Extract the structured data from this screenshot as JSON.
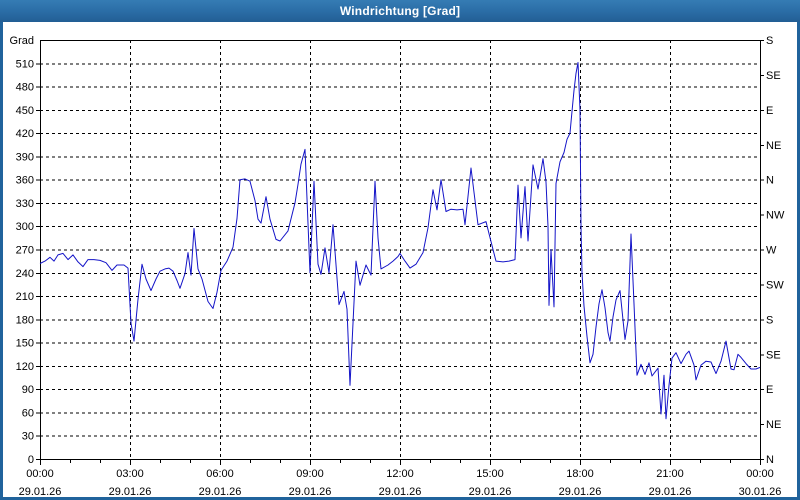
{
  "window": {
    "title": "Windrichtung [Grad]"
  },
  "colors": {
    "titlebar_blue": "#2a6ca5",
    "window_border_blue": "#20639c",
    "plot_background": "#ffffff",
    "grid_black": "#000000",
    "series_blue": "#1414c8"
  },
  "chart_data": {
    "type": "line",
    "title": "Windrichtung [Grad]",
    "grid": "on",
    "legend": "none",
    "y_axis": {
      "header_label": "Grad",
      "min": 0,
      "max": 540,
      "tick_step": 30,
      "tick_labels": [
        510,
        480,
        450,
        420,
        390,
        360,
        330,
        300,
        270,
        240,
        210,
        180,
        150,
        120,
        90,
        60,
        30,
        0
      ]
    },
    "right_axis": {
      "tick_step": 45,
      "labels_top_to_bottom": [
        "S",
        "SE",
        "E",
        "NE",
        "N",
        "NW",
        "W",
        "SW",
        "S",
        "SE",
        "E",
        "NE",
        "N"
      ]
    },
    "x_axis": {
      "range_minutes": 1440,
      "minor_tick_minutes": 60,
      "major_tick_minutes": 180,
      "major_ticks": [
        {
          "time": "00:00",
          "date": "29.01.26"
        },
        {
          "time": "03:00",
          "date": "29.01.26"
        },
        {
          "time": "06:00",
          "date": "29.01.26"
        },
        {
          "time": "09:00",
          "date": "29.01.26"
        },
        {
          "time": "12:00",
          "date": "29.01.26"
        },
        {
          "time": "15:00",
          "date": "29.01.26"
        },
        {
          "time": "18:00",
          "date": "29.01.26"
        },
        {
          "time": "21:00",
          "date": "29.01.26"
        },
        {
          "time": "00:00",
          "date": "30.01.26"
        }
      ]
    },
    "series": [
      {
        "name": "Windrichtung",
        "color": "#1414c8",
        "points_minutes_grad": [
          [
            0,
            252
          ],
          [
            10,
            255
          ],
          [
            20,
            260
          ],
          [
            28,
            255
          ],
          [
            36,
            263
          ],
          [
            46,
            265
          ],
          [
            56,
            257
          ],
          [
            66,
            263
          ],
          [
            76,
            254
          ],
          [
            86,
            248
          ],
          [
            96,
            257
          ],
          [
            108,
            257
          ],
          [
            120,
            256
          ],
          [
            132,
            253
          ],
          [
            144,
            243
          ],
          [
            154,
            250
          ],
          [
            168,
            250
          ],
          [
            176,
            246
          ],
          [
            182,
            175
          ],
          [
            188,
            152
          ],
          [
            196,
            206
          ],
          [
            204,
            251
          ],
          [
            212,
            232
          ],
          [
            222,
            217
          ],
          [
            232,
            232
          ],
          [
            240,
            242
          ],
          [
            250,
            245
          ],
          [
            258,
            246
          ],
          [
            266,
            242
          ],
          [
            274,
            230
          ],
          [
            280,
            220
          ],
          [
            290,
            239
          ],
          [
            296,
            266
          ],
          [
            302,
            237
          ],
          [
            308,
            297
          ],
          [
            316,
            245
          ],
          [
            324,
            232
          ],
          [
            336,
            203
          ],
          [
            346,
            194
          ],
          [
            354,
            215
          ],
          [
            362,
            243
          ],
          [
            374,
            255
          ],
          [
            386,
            273
          ],
          [
            394,
            310
          ],
          [
            400,
            360
          ],
          [
            410,
            361
          ],
          [
            420,
            358
          ],
          [
            430,
            333
          ],
          [
            436,
            309
          ],
          [
            442,
            304
          ],
          [
            452,
            338
          ],
          [
            460,
            309
          ],
          [
            472,
            283
          ],
          [
            480,
            281
          ],
          [
            496,
            294
          ],
          [
            510,
            330
          ],
          [
            516,
            354
          ],
          [
            522,
            380
          ],
          [
            530,
            399
          ],
          [
            540,
            240
          ],
          [
            548,
            358
          ],
          [
            556,
            251
          ],
          [
            562,
            238
          ],
          [
            570,
            272
          ],
          [
            578,
            240
          ],
          [
            586,
            302
          ],
          [
            598,
            199
          ],
          [
            608,
            216
          ],
          [
            614,
            193
          ],
          [
            620,
            95
          ],
          [
            632,
            255
          ],
          [
            640,
            224
          ],
          [
            652,
            250
          ],
          [
            662,
            237
          ],
          [
            670,
            358
          ],
          [
            676,
            285
          ],
          [
            682,
            245
          ],
          [
            696,
            250
          ],
          [
            706,
            255
          ],
          [
            716,
            261
          ],
          [
            720,
            265
          ],
          [
            730,
            255
          ],
          [
            740,
            246
          ],
          [
            752,
            251
          ],
          [
            766,
            266
          ],
          [
            776,
            298
          ],
          [
            786,
            347
          ],
          [
            794,
            321
          ],
          [
            802,
            360
          ],
          [
            812,
            319
          ],
          [
            822,
            322
          ],
          [
            834,
            321
          ],
          [
            846,
            322
          ],
          [
            850,
            302
          ],
          [
            862,
            375
          ],
          [
            876,
            302
          ],
          [
            892,
            306
          ],
          [
            906,
            270
          ],
          [
            912,
            255
          ],
          [
            926,
            254
          ],
          [
            938,
            255
          ],
          [
            950,
            257
          ],
          [
            956,
            353
          ],
          [
            962,
            285
          ],
          [
            970,
            351
          ],
          [
            976,
            281
          ],
          [
            986,
            379
          ],
          [
            996,
            348
          ],
          [
            1006,
            387
          ],
          [
            1012,
            357
          ],
          [
            1016,
            300
          ],
          [
            1018,
            198
          ],
          [
            1022,
            270
          ],
          [
            1028,
            196
          ],
          [
            1032,
            355
          ],
          [
            1040,
            383
          ],
          [
            1048,
            395
          ],
          [
            1054,
            412
          ],
          [
            1060,
            420
          ],
          [
            1064,
            448
          ],
          [
            1068,
            475
          ],
          [
            1072,
            497
          ],
          [
            1076,
            511
          ],
          [
            1080,
            450
          ],
          [
            1082,
            300
          ],
          [
            1084,
            240
          ],
          [
            1088,
            197
          ],
          [
            1094,
            158
          ],
          [
            1100,
            124
          ],
          [
            1106,
            135
          ],
          [
            1112,
            170
          ],
          [
            1118,
            200
          ],
          [
            1124,
            218
          ],
          [
            1130,
            195
          ],
          [
            1136,
            163
          ],
          [
            1140,
            152
          ],
          [
            1146,
            183
          ],
          [
            1152,
            205
          ],
          [
            1160,
            217
          ],
          [
            1170,
            154
          ],
          [
            1176,
            178
          ],
          [
            1182,
            290
          ],
          [
            1188,
            200
          ],
          [
            1194,
            108
          ],
          [
            1202,
            122
          ],
          [
            1210,
            109
          ],
          [
            1218,
            124
          ],
          [
            1224,
            107
          ],
          [
            1230,
            112
          ],
          [
            1236,
            117
          ],
          [
            1242,
            58
          ],
          [
            1248,
            108
          ],
          [
            1252,
            52
          ],
          [
            1258,
            95
          ],
          [
            1264,
            130
          ],
          [
            1272,
            137
          ],
          [
            1282,
            123
          ],
          [
            1292,
            135
          ],
          [
            1298,
            139
          ],
          [
            1308,
            121
          ],
          [
            1312,
            102
          ],
          [
            1322,
            121
          ],
          [
            1332,
            126
          ],
          [
            1342,
            125
          ],
          [
            1352,
            110
          ],
          [
            1362,
            126
          ],
          [
            1372,
            152
          ],
          [
            1382,
            116
          ],
          [
            1388,
            115
          ],
          [
            1396,
            135
          ],
          [
            1402,
            131
          ],
          [
            1412,
            123
          ],
          [
            1422,
            116
          ],
          [
            1432,
            116
          ],
          [
            1440,
            118
          ]
        ]
      }
    ]
  }
}
